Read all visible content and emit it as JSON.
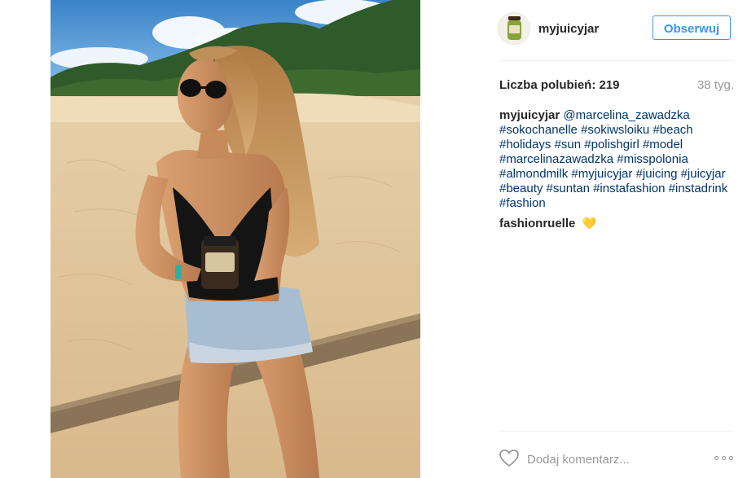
{
  "post": {
    "author": "myjuicyjar",
    "follow_label": "Obserwuj",
    "likes_text": "Liczba polubień: 219",
    "age": "38 tyg.",
    "caption_user": "myjuicyjar",
    "caption_mention": "@marcelina_zawadzka",
    "caption_tags": "#sokochanelle #sokiwsloiku #beach #holidays #sun #polishgirl #model #marcelinazawadzka #misspolonia #almondmilk #myjuicyjar #juicing #juicyjar #beauty #suntan #instafashion #instadrink #fashion",
    "comments": [
      {
        "user": "fashionruelle",
        "text": "💛"
      }
    ],
    "comment_placeholder": "Dodaj komentarz...",
    "icons": {
      "like": "heart-outline-icon",
      "more": "ellipsis-icon"
    }
  },
  "colors": {
    "link": "#003569",
    "follow": "#3897f0",
    "muted": "#999999"
  }
}
